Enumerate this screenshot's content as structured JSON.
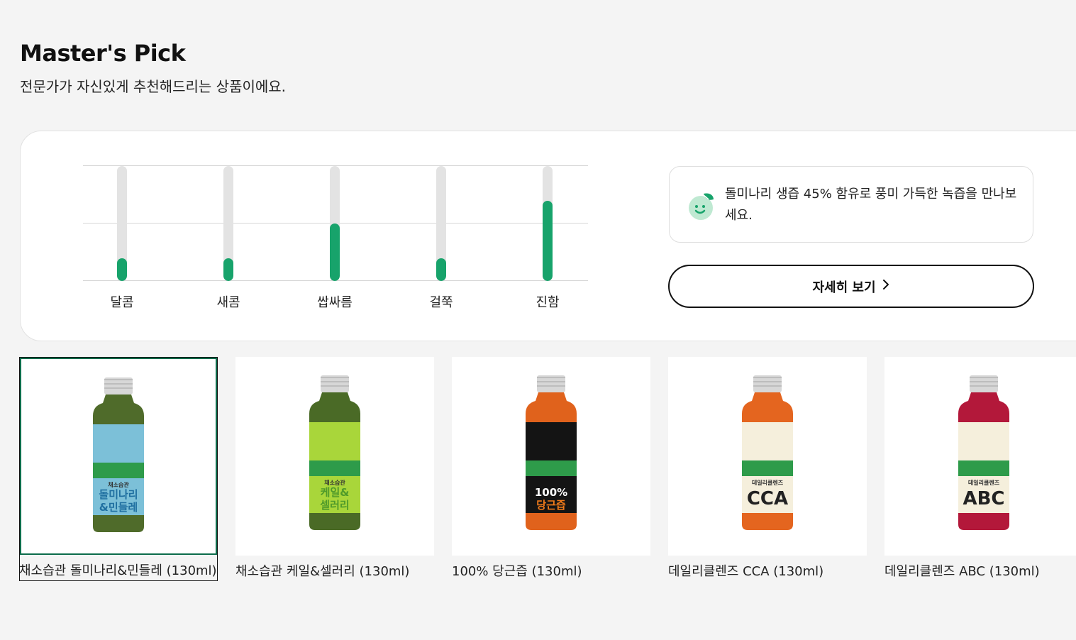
{
  "header": {
    "title": "Master's Pick",
    "subtitle": "전문가가 자신있게 추천해드리는 상품이에요."
  },
  "taste_profile": {
    "attributes": [
      {
        "label": "달콤",
        "level": 0.2
      },
      {
        "label": "새콤",
        "level": 0.2
      },
      {
        "label": "쌉싸름",
        "level": 0.5
      },
      {
        "label": "걸쭉",
        "level": 0.2
      },
      {
        "label": "진함",
        "level": 0.7
      }
    ],
    "fill_color": "#17a36b",
    "track_color": "#e3e3e3"
  },
  "info": {
    "icon": "leaf-face-icon",
    "text": "돌미나리 생즙 45% 함유로 풍미 가득한 녹즙을 만나보세요."
  },
  "detail_button": {
    "label": "자세히 보기",
    "icon": "chevron-right-icon"
  },
  "products": [
    {
      "name": "채소습관 돌미나리&민들레 (130ml)",
      "selected": true,
      "bottle_color": "#4f6b2a",
      "label_color": "#7cc0d8",
      "label_text_1": "채소습관",
      "label_text_2": "돌미나리",
      "label_text_3": "&민들레",
      "text_color": "#1f6fa0"
    },
    {
      "name": "채소습관 케일&셀러리 (130ml)",
      "selected": false,
      "bottle_color": "#4a6a26",
      "label_color": "#a9d63a",
      "label_text_1": "채소습관",
      "label_text_2": "케일&",
      "label_text_3": "셀러리",
      "text_color": "#4f9a2a"
    },
    {
      "name": "100% 당근즙 (130ml)",
      "selected": false,
      "bottle_color": "#e0621c",
      "label_color": "#141414",
      "label_text_1": "",
      "label_text_2": "100%",
      "label_text_3": "당근즙",
      "text_color": "#f07a1a"
    },
    {
      "name": "데일리클렌즈 CCA (130ml)",
      "selected": false,
      "bottle_color": "#e4651f",
      "label_color": "#f5efdc",
      "label_text_1": "데일리클렌즈",
      "label_text_2": "CCA",
      "label_text_3": "",
      "text_color": "#222"
    },
    {
      "name": "데일리클렌즈 ABC (130ml)",
      "selected": false,
      "bottle_color": "#b3183a",
      "label_color": "#f5efdc",
      "label_text_1": "데일리클렌즈",
      "label_text_2": "ABC",
      "label_text_3": "",
      "text_color": "#222"
    }
  ]
}
